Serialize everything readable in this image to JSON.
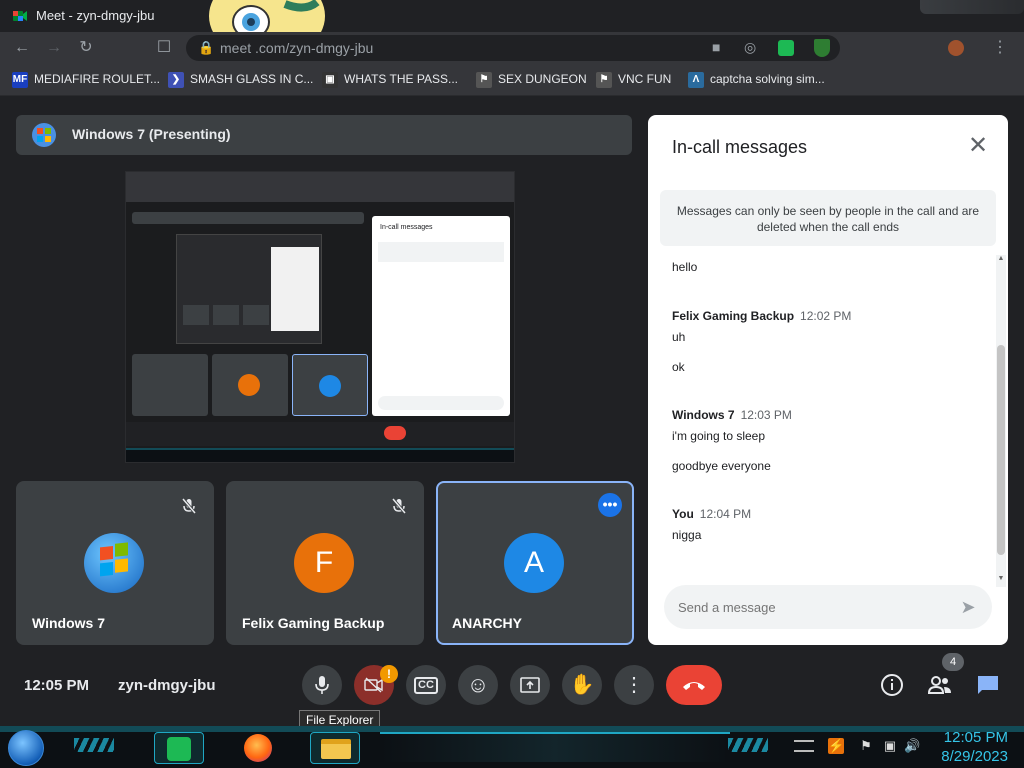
{
  "browser": {
    "tab_title": "Meet - zyn-dmgy-jbu",
    "url": "meet.google.com/zyn-dmgy-jbu",
    "url_visible": "meet   .com/zyn-dmgy-jbu"
  },
  "bookmarks": [
    {
      "label": "MEDIAFIRE ROULET...",
      "icon": "mediafire-icon",
      "color": "#1a3fbf"
    },
    {
      "label": "SMASH GLASS IN C...",
      "icon": "chevron-icon",
      "color": "#3f51b5"
    },
    {
      "label": "WHATS THE PASS...",
      "icon": "page-icon",
      "color": "#333333"
    },
    {
      "label": "SEX DUNGEON",
      "icon": "ghost-icon",
      "color": "#555555"
    },
    {
      "label": "VNC FUN",
      "icon": "ghost-icon",
      "color": "#555555"
    },
    {
      "label": "captcha solving sim...",
      "icon": "triangle-icon",
      "color": "#2a6b9e"
    }
  ],
  "presenting": {
    "label": "Windows 7 (Presenting)"
  },
  "tiles": [
    {
      "name": "Windows 7",
      "avatar_letter": "",
      "avatar_icon": "windows-logo-icon",
      "muted": true
    },
    {
      "name": "Felix Gaming Backup",
      "avatar_letter": "F",
      "avatar_color": "#e8710a",
      "muted": true
    },
    {
      "name": "ANARCHY",
      "avatar_letter": "A",
      "avatar_color": "#1e88e5",
      "muted": false,
      "active": true
    }
  ],
  "panel": {
    "title": "In-call messages",
    "notice": "Messages can only be seen by people in the call and are deleted when the call ends",
    "compose_placeholder": "Send a message",
    "messages": [
      {
        "sender": "",
        "time": "",
        "lines": [
          "hello"
        ]
      },
      {
        "sender": "Felix Gaming Backup",
        "time": "12:02 PM",
        "lines": [
          "uh",
          "ok"
        ]
      },
      {
        "sender": "Windows 7",
        "time": "12:03 PM",
        "lines": [
          "i'm going to sleep",
          "goodbye everyone"
        ]
      },
      {
        "sender": "You",
        "time": "12:04 PM",
        "lines": [
          "nigga"
        ]
      }
    ]
  },
  "controls": {
    "clock": "12:05 PM",
    "meeting_code": "zyn-dmgy-jbu",
    "camera_alert": "!",
    "people_count": "4",
    "tooltip": "File Explorer"
  },
  "taskbar": {
    "time": "12:05 PM",
    "date": "8/29/2023"
  },
  "colors": {
    "meet_bg": "#202124",
    "tile_bg": "#3c4043",
    "end_call": "#ea4335",
    "accent_blue": "#1a73e8",
    "tray_text": "#35c5e8"
  }
}
